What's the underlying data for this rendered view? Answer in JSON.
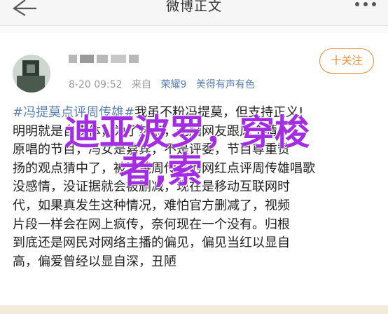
{
  "nav": {
    "title": "微博正文",
    "back_icon": "back-arrow-icon",
    "more_icon": "more-dots-icon"
  },
  "author": {
    "time": "8-20 09:52",
    "source_prefix": "来自",
    "device": "荣耀9",
    "device_tagline": "美得有声有色"
  },
  "follow_button": "十关注",
  "post": {
    "line1_hashtag": "#冯提莫点评周传雄#",
    "line1_rest": "我虽不粉冯提莫，但支持正义!",
    "lines": [
      "明明就是自媒体，为了热点，无脑网友跟风个猜",
      "原唱的节目，冯女是嘉宾，不是评委，节目尊重赞",
      "扬的观点猜中了，被污蔑周传雄的网红点评周传雄唱歌",
      "没感情，没证据就会被删减，现在是移动互联网时",
      "代，如果真发生这种情况，难怕官方删减了，视频",
      "片段一样会在网上疯传，奈何现在一个没有。归根",
      "到底还是网民对网络主播的偏见，偏见当红以显自",
      "高，偏爱曾经以显自深，丑陋"
    ]
  },
  "watermark": {
    "line1": "迪亚波罗，穿梭",
    "line2": "者,索"
  },
  "colors": {
    "accent": "#f08a2c",
    "link": "#5b7fb1",
    "watermark": "#a32de0"
  }
}
